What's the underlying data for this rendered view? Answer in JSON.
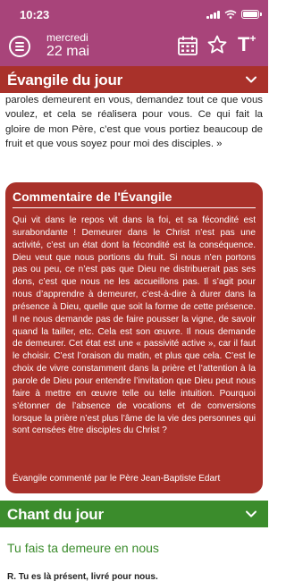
{
  "status_bar": {
    "time": "10:23"
  },
  "header": {
    "weekday": "mercredi",
    "day": "22 mai",
    "text_button": "T",
    "text_button_sup": "+"
  },
  "evangile": {
    "title": "Évangile du jour",
    "text": "paroles demeurent en vous, demandez tout ce que vous voulez, et cela se réalisera pour vous. Ce qui fait la gloire de mon Père, c’est que vous portiez beaucoup de fruit et que vous soyez pour moi des disciples. »"
  },
  "commentaire": {
    "title": "Commentaire de l'Évangile",
    "text": "Qui vit dans le repos vit dans la foi, et sa fécondité est surabondante ! Demeurer dans le Christ n’est pas une activité, c’est un état dont la fécondité est la conséquence. Dieu veut que nous portions du fruit. Si nous n’en portons pas ou peu, ce n’est pas que Dieu ne distribuerait pas ses dons, c’est que nous ne les accueillons pas. Il s’agit pour nous d’apprendre à demeurer, c’est-à-dire à durer dans la présence à Dieu, quelle que soit la forme de cette présence. Il ne nous demande pas de faire pousser la vigne, de savoir quand la tailler, etc. Cela est son œuvre. Il nous demande de demeurer. Cet état est une « passivité active », car il faut le choisir. C’est l’oraison du matin, et plus que cela. C’est le choix de vivre constamment dans la prière et l’attention à la parole de Dieu pour entendre l’invitation que Dieu peut nous faire à mettre en œuvre telle ou telle intuition. Pourquoi s’étonner de l’absence de vocations et de conversions lorsque la prière n’est plus l’âme de la vie des personnes qui sont censées être disciples du Christ ?",
    "author": "Évangile commenté par le Père Jean-Baptiste Edart"
  },
  "chant": {
    "title": "Chant du jour",
    "song_title": "Tu fais ta demeure en nous",
    "first_line": "R. Tu es là présent, livré pour nous."
  },
  "colors": {
    "header": "#a8447a",
    "evangile": "#a9312a",
    "chant": "#3b8c2c"
  },
  "icons": {
    "menu": "menu-icon",
    "calendar": "calendar-icon",
    "star": "star-icon",
    "chevron": "chevron-down-icon"
  }
}
